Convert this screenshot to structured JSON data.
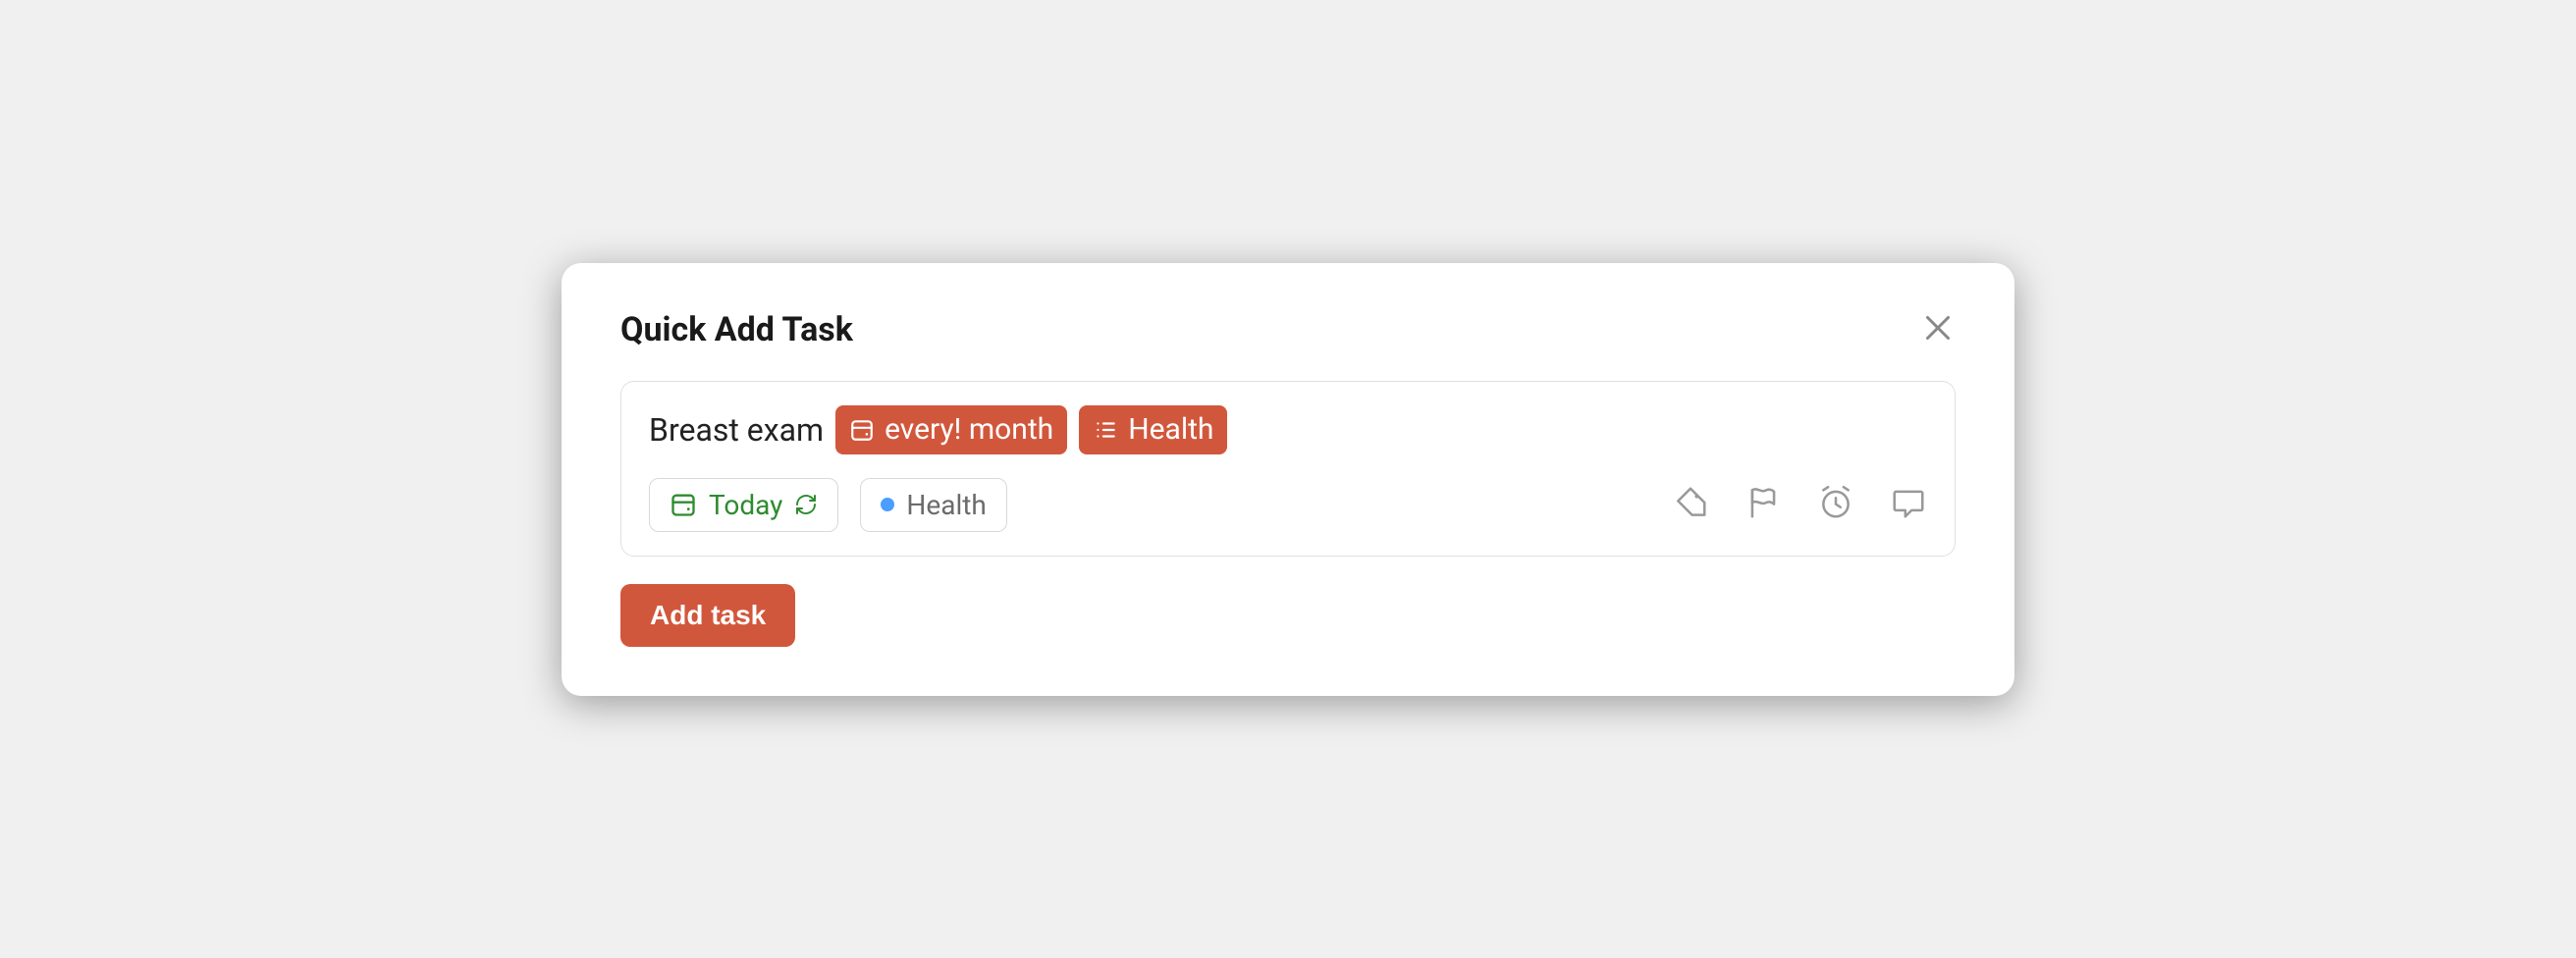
{
  "dialog": {
    "title": "Quick Add Task"
  },
  "task": {
    "text": "Breast exam",
    "schedule_token": "every! month",
    "project_token": "Health"
  },
  "chips": {
    "date_label": "Today",
    "project_label": "Health"
  },
  "actions": {
    "add_button": "Add task"
  },
  "colors": {
    "accent": "#d1573c",
    "date_green": "#2e8b2e",
    "project_dot": "#4a9eff"
  }
}
